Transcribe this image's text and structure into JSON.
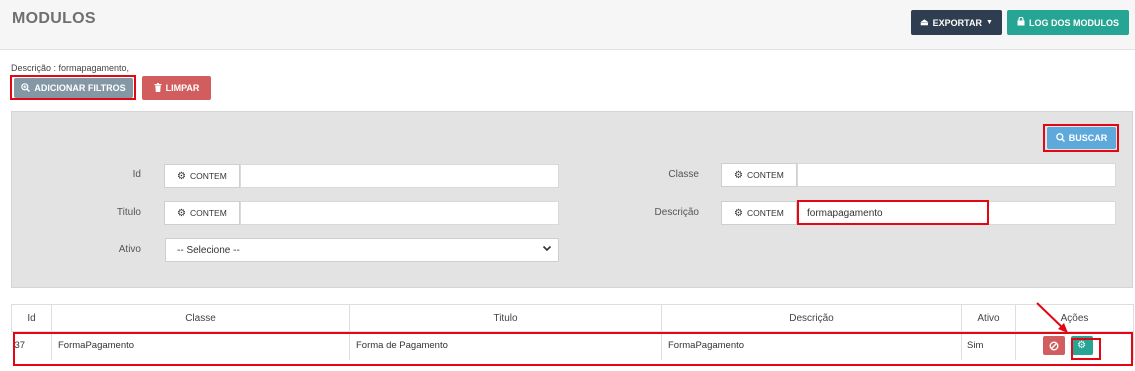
{
  "header": {
    "title": "MODULOS",
    "export_label": "EXPORTAR",
    "log_label": "LOG DOS MODULOS",
    "export_icon": "eject-icon",
    "log_icon": "lock-icon"
  },
  "filters_bar": {
    "description": "Descrição : formapagamento,",
    "add_label": "ADICIONAR FILTROS",
    "clear_label": "LIMPAR"
  },
  "search": {
    "button_label": "BUSCAR",
    "operator_label": "CONTEM",
    "fields": {
      "id": {
        "label": "Id",
        "value": ""
      },
      "titulo": {
        "label": "Titulo",
        "value": ""
      },
      "ativo": {
        "label": "Ativo",
        "value": "-- Selecione --"
      },
      "classe": {
        "label": "Classe",
        "value": ""
      },
      "descricao": {
        "label": "Descrição",
        "value": "formapagamento"
      }
    }
  },
  "table": {
    "columns": [
      "Id",
      "Classe",
      "Titulo",
      "Descrição",
      "Ativo",
      "Ações"
    ],
    "rows": [
      {
        "id": "37",
        "classe": "FormaPagamento",
        "titulo": "Forma de Pagamento",
        "descricao": "FormaPagamento",
        "ativo": "Sim"
      }
    ]
  },
  "colors": {
    "header_bg": "#f6f6f6",
    "export_btn": "#2e3d50",
    "log_btn": "#26a594",
    "add_filter_btn": "#8497a4",
    "clear_btn": "#d25d5f",
    "search_btn": "#5ea9dc",
    "highlight": "#e30613"
  }
}
